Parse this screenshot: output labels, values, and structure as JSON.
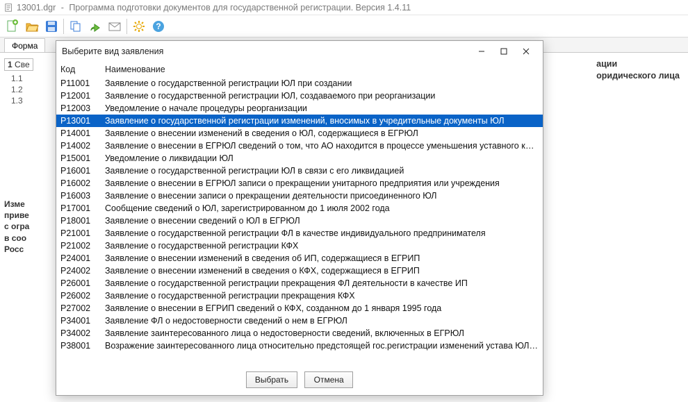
{
  "app": {
    "filename": "13001.dgr",
    "title_suffix": "Программа подготовки документов для государственной регистрации. Версия 1.4.11"
  },
  "tabs": {
    "main": "Форма"
  },
  "tree": {
    "top": "1",
    "top_label": "Све",
    "i1": "1.1",
    "i2": "1.2",
    "i3": "1.3"
  },
  "bg_text": {
    "l1": "Изме",
    "l2": "приве",
    "l3": "с огра",
    "l4": "в соо",
    "l5": "Росс"
  },
  "right_text": {
    "l1": "ации",
    "l2": "оридического лица"
  },
  "modal": {
    "title": "Выберите вид заявления",
    "col_code": "Код",
    "col_name": "Наименование",
    "select_btn": "Выбрать",
    "cancel_btn": "Отмена",
    "selected_code": "Р13001",
    "rows": [
      {
        "code": "Р11001",
        "name": "Заявление о государственной регистрации ЮЛ при создании"
      },
      {
        "code": "Р12001",
        "name": "Заявление о государственной регистрации ЮЛ, создаваемого при реорганизации"
      },
      {
        "code": "Р12003",
        "name": "Уведомление о начале процедуры реорганизации"
      },
      {
        "code": "Р13001",
        "name": "Заявление о государственной регистрации изменений, вносимых в учредительные документы ЮЛ"
      },
      {
        "code": "Р14001",
        "name": "Заявление о внесении изменений в сведения о ЮЛ, содержащиеся в ЕГРЮЛ"
      },
      {
        "code": "Р14002",
        "name": "Заявление о внесении в ЕГРЮЛ сведений о том, что АО находится в процессе уменьшения уставного капитала, а так…"
      },
      {
        "code": "Р15001",
        "name": "Уведомление о ликвидации ЮЛ"
      },
      {
        "code": "Р16001",
        "name": "Заявление о государственной регистрации ЮЛ в связи с его ликвидацией"
      },
      {
        "code": "Р16002",
        "name": "Заявление о внесении в ЕГРЮЛ записи о прекращении унитарного предприятия или учреждения"
      },
      {
        "code": "Р16003",
        "name": "Заявление о внесении записи о прекращении деятельности присоединенного ЮЛ"
      },
      {
        "code": "Р17001",
        "name": "Сообщение сведений о ЮЛ, зарегистрированном до 1 июля 2002 года"
      },
      {
        "code": "Р18001",
        "name": "Заявление о внесении сведений о ЮЛ в ЕГРЮЛ"
      },
      {
        "code": "Р21001",
        "name": "Заявление о государственной регистрации ФЛ в качестве индивидуального предпринимателя"
      },
      {
        "code": "Р21002",
        "name": "Заявление о государственной регистрации КФХ"
      },
      {
        "code": "Р24001",
        "name": "Заявление о внесении изменений в сведения об ИП, содержащиеся в ЕГРИП"
      },
      {
        "code": "Р24002",
        "name": "Заявление о внесении изменений в сведения о КФХ, содержащиеся в ЕГРИП"
      },
      {
        "code": "Р26001",
        "name": "Заявление о государственной регистрации прекращения ФЛ деятельности в качестве ИП"
      },
      {
        "code": "Р26002",
        "name": "Заявление о государственной регистрации прекращения КФХ"
      },
      {
        "code": "Р27002",
        "name": "Заявление о внесении в ЕГРИП сведений о КФХ, созданном до 1 января 1995 года"
      },
      {
        "code": "Р34001",
        "name": "Заявление ФЛ о недостоверности сведений о нем в ЕГРЮЛ"
      },
      {
        "code": "Р34002",
        "name": "Заявление заинтересованного лица о недостоверности сведений, включенных в ЕГРЮЛ"
      },
      {
        "code": "Р38001",
        "name": "Возражение заинтересованного лица относительно предстоящей гос.регистрации изменений устава ЮЛ или предсто…"
      }
    ]
  },
  "icons": {
    "new": "new",
    "open": "open",
    "save": "save",
    "copy": "copy",
    "send": "send",
    "mail": "mail",
    "settings": "settings",
    "help": "help"
  }
}
